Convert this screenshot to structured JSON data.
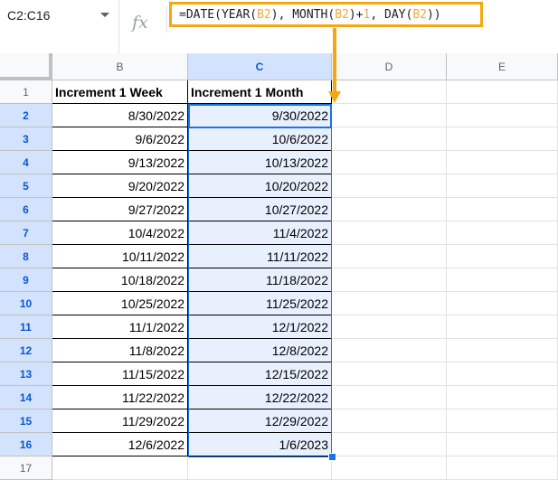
{
  "name_box": "C2:C16",
  "formula": {
    "p1": "=DATE(YEAR(",
    "r1": "B2",
    "p2": "), MONTH(",
    "r2": "B2",
    "p3": ")+",
    "n1": "1",
    "p4": ", DAY(",
    "r3": "B2",
    "p5": "))"
  },
  "fx_label": "fx",
  "columns": [
    "B",
    "C",
    "D",
    "E"
  ],
  "rows": [
    "1",
    "2",
    "3",
    "4",
    "5",
    "6",
    "7",
    "8",
    "9",
    "10",
    "11",
    "12",
    "13",
    "14",
    "15",
    "16",
    "17"
  ],
  "headers": {
    "b": "Increment 1 Week",
    "c": "Increment 1 Month"
  },
  "data": [
    {
      "b": "8/30/2022",
      "c": "9/30/2022"
    },
    {
      "b": "9/6/2022",
      "c": "10/6/2022"
    },
    {
      "b": "9/13/2022",
      "c": "10/13/2022"
    },
    {
      "b": "9/20/2022",
      "c": "10/20/2022"
    },
    {
      "b": "9/27/2022",
      "c": "10/27/2022"
    },
    {
      "b": "10/4/2022",
      "c": "11/4/2022"
    },
    {
      "b": "10/11/2022",
      "c": "11/11/2022"
    },
    {
      "b": "10/18/2022",
      "c": "11/18/2022"
    },
    {
      "b": "10/25/2022",
      "c": "11/25/2022"
    },
    {
      "b": "11/1/2022",
      "c": "12/1/2022"
    },
    {
      "b": "11/8/2022",
      "c": "12/8/2022"
    },
    {
      "b": "11/15/2022",
      "c": "12/15/2022"
    },
    {
      "b": "11/22/2022",
      "c": "12/22/2022"
    },
    {
      "b": "11/29/2022",
      "c": "12/29/2022"
    },
    {
      "b": "12/6/2022",
      "c": "1/6/2023"
    }
  ],
  "colors": {
    "highlight": "#f3a712",
    "selection": "#1a73e8"
  }
}
